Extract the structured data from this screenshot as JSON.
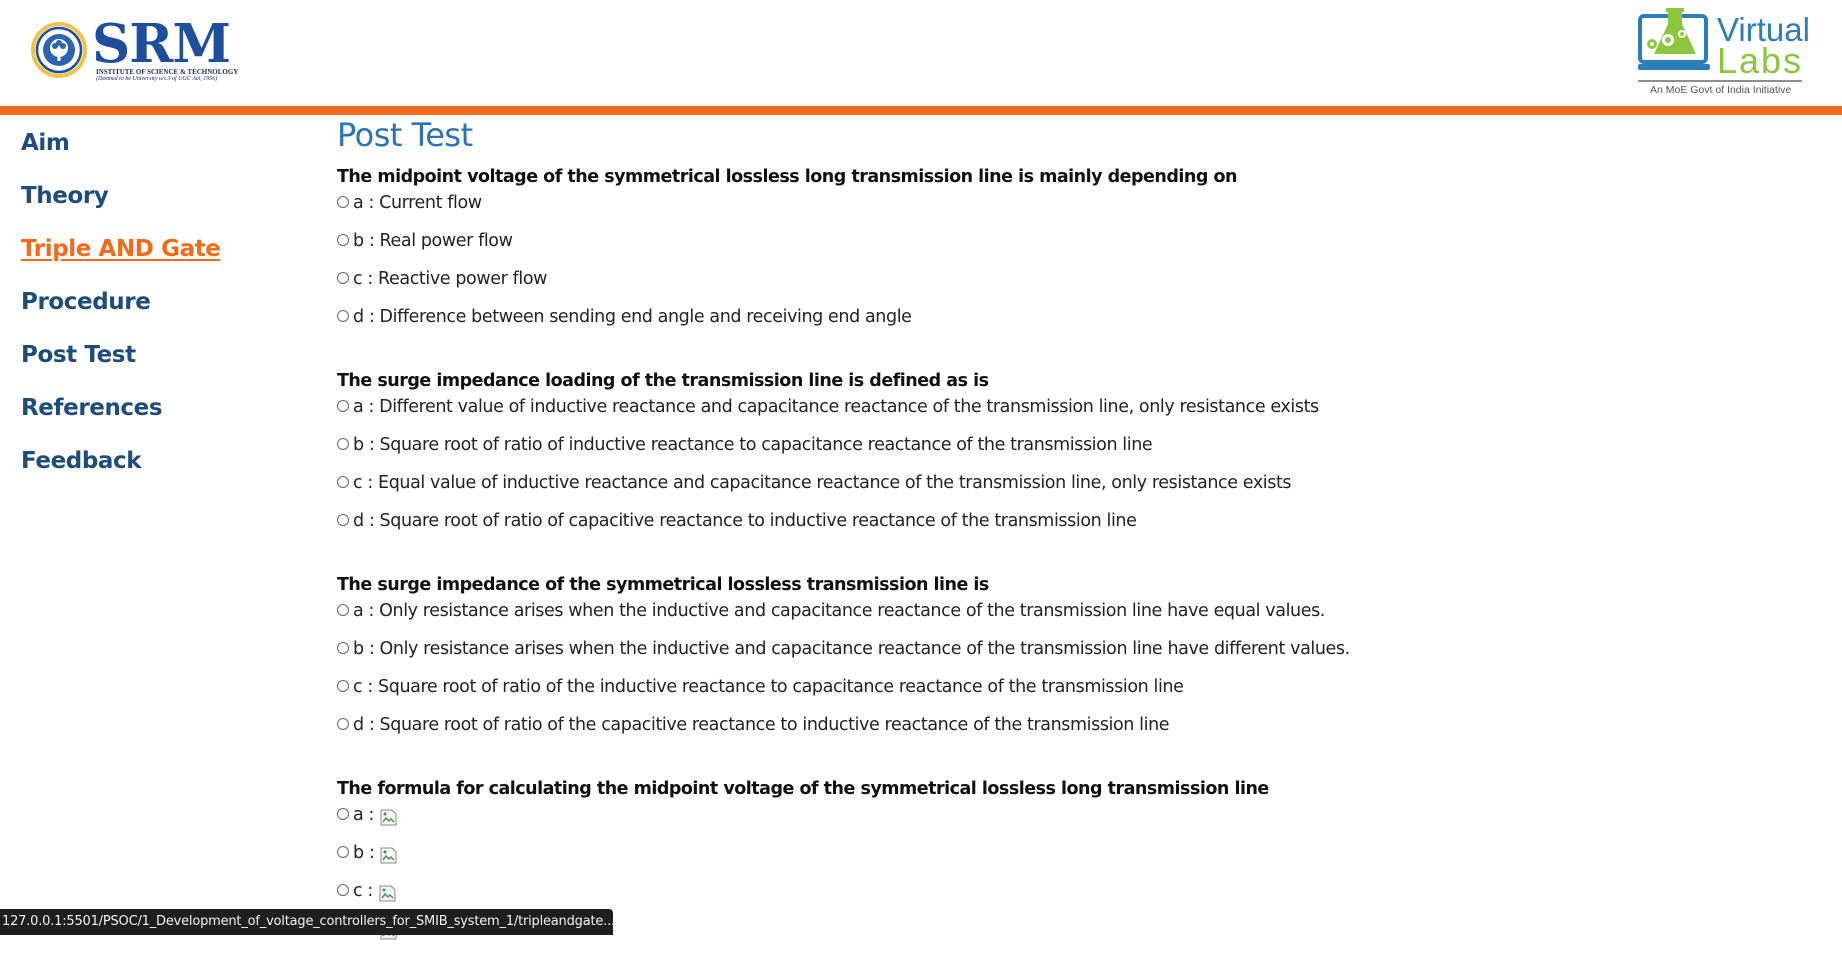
{
  "header": {
    "srm_logo": {
      "wordmark": "SRM",
      "line1": "INSTITUTE OF SCIENCE & TECHNOLOGY",
      "line2": "(Deemed to be University u/s 3 of UGC Act, 1956)"
    },
    "vlabs_logo": {
      "word1": "Virtual",
      "word2": "Labs",
      "tagline": "An MoE Govt of India Initiative"
    },
    "accent_color": "#f26b1d"
  },
  "sidebar": {
    "items": [
      {
        "label": "Aim",
        "active": false
      },
      {
        "label": "Theory",
        "active": false
      },
      {
        "label": "Triple AND Gate",
        "active": true
      },
      {
        "label": "Procedure",
        "active": false
      },
      {
        "label": "Post Test",
        "active": false
      },
      {
        "label": "References",
        "active": false
      },
      {
        "label": "Feedback",
        "active": false
      }
    ]
  },
  "main": {
    "title": "Post Test",
    "questions": [
      {
        "text": "The midpoint voltage of the symmetrical lossless long transmission line is mainly depending on",
        "options": [
          "a : Current flow",
          "b : Real power flow",
          "c : Reactive power flow",
          "d : Difference between sending end angle and receiving end angle"
        ]
      },
      {
        "text": "The surge impedance loading of the transmission line is defined as is",
        "options": [
          "a : Different value of inductive reactance and capacitance reactance of the transmission line, only resistance exists",
          "b : Square root of ratio of inductive reactance to capacitance reactance of the transmission line",
          "c : Equal value of inductive reactance and capacitance reactance of the transmission line, only resistance exists",
          "d : Square root of ratio of capacitive reactance to inductive reactance of the transmission line"
        ]
      },
      {
        "text": "The surge impedance of the symmetrical lossless transmission line is",
        "options": [
          "a : Only resistance arises when the inductive and capacitance reactance of the transmission line have equal values.",
          "b : Only resistance arises when the inductive and capacitance reactance of the transmission line have different values.",
          "c : Square root of ratio of the inductive reactance to capacitance reactance of the transmission line",
          "d : Square root of ratio of the capacitive reactance to inductive reactance of the transmission line"
        ]
      },
      {
        "text": "The formula for calculating the midpoint voltage of the symmetrical lossless long transmission line",
        "options": [
          "a :",
          "b :",
          "c :",
          "d :"
        ]
      }
    ]
  },
  "status_bar": {
    "url": "127.0.0.1:5501/PSOC/1_Development_of_voltage_controllers_for_SMIB_system_1/tripleandgate...."
  }
}
